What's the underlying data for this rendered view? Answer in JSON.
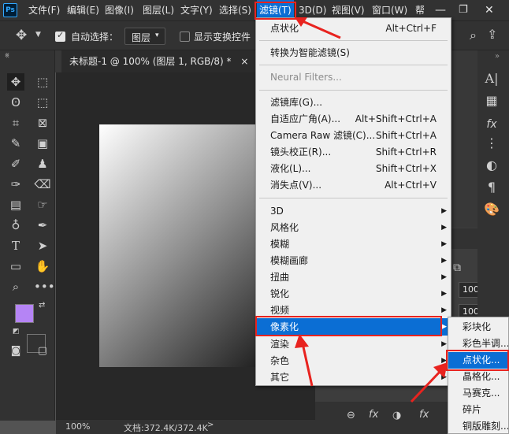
{
  "app": {
    "logo": "Ps",
    "logo_color": "#31a8ff"
  },
  "menubar": {
    "items": [
      "文件(F)",
      "编辑(E)",
      "图像(I)",
      "图层(L)",
      "文字(Y)",
      "选择(S)",
      "滤镜(T)",
      "3D(D)",
      "视图(V)",
      "窗口(W)",
      "帮"
    ],
    "active": "滤镜(T)"
  },
  "options": {
    "auto_select_label": "自动选择：",
    "auto_select_checked": true,
    "layer_value": "图层",
    "show_transform_label": "显示变换控件"
  },
  "document": {
    "tab_title": "未标题-1 @ 100% (图层 1, RGB/8) *",
    "close": "×"
  },
  "status": {
    "zoom": "100%",
    "doc_info": "文档:372.4K/372.4K"
  },
  "filter_menu": {
    "top_items": [
      {
        "label": "点状化",
        "shortcut": "Alt+Ctrl+F"
      }
    ],
    "convert": "转换为智能滤镜(S)",
    "neural": "Neural Filters...",
    "gallery_items": [
      {
        "label": "滤镜库(G)...",
        "shortcut": ""
      },
      {
        "label": "自适应广角(A)...",
        "shortcut": "Alt+Shift+Ctrl+A"
      },
      {
        "label": "Camera Raw 滤镜(C)...",
        "shortcut": "Shift+Ctrl+A"
      },
      {
        "label": "镜头校正(R)...",
        "shortcut": "Shift+Ctrl+R"
      },
      {
        "label": "液化(L)...",
        "shortcut": "Shift+Ctrl+X"
      },
      {
        "label": "消失点(V)...",
        "shortcut": "Alt+Ctrl+V"
      }
    ],
    "submenus": [
      "3D",
      "风格化",
      "模糊",
      "模糊画廊",
      "扭曲",
      "锐化",
      "视频",
      "像素化",
      "渲染",
      "杂色",
      "其它"
    ],
    "highlighted": "像素化"
  },
  "pixelate_submenu": {
    "items": [
      "彩块化",
      "彩色半调...",
      "点状化...",
      "晶格化...",
      "马赛克...",
      "碎片",
      "铜版雕刻..."
    ],
    "highlighted": "点状化..."
  },
  "right_panel": {
    "zoom_values": [
      "100%",
      "100%"
    ]
  },
  "colors": {
    "accent": "#0b6ed4",
    "annotation": "#e8231f",
    "foreground_swatch": "#b584f5",
    "background_swatch": "#ffffff"
  }
}
